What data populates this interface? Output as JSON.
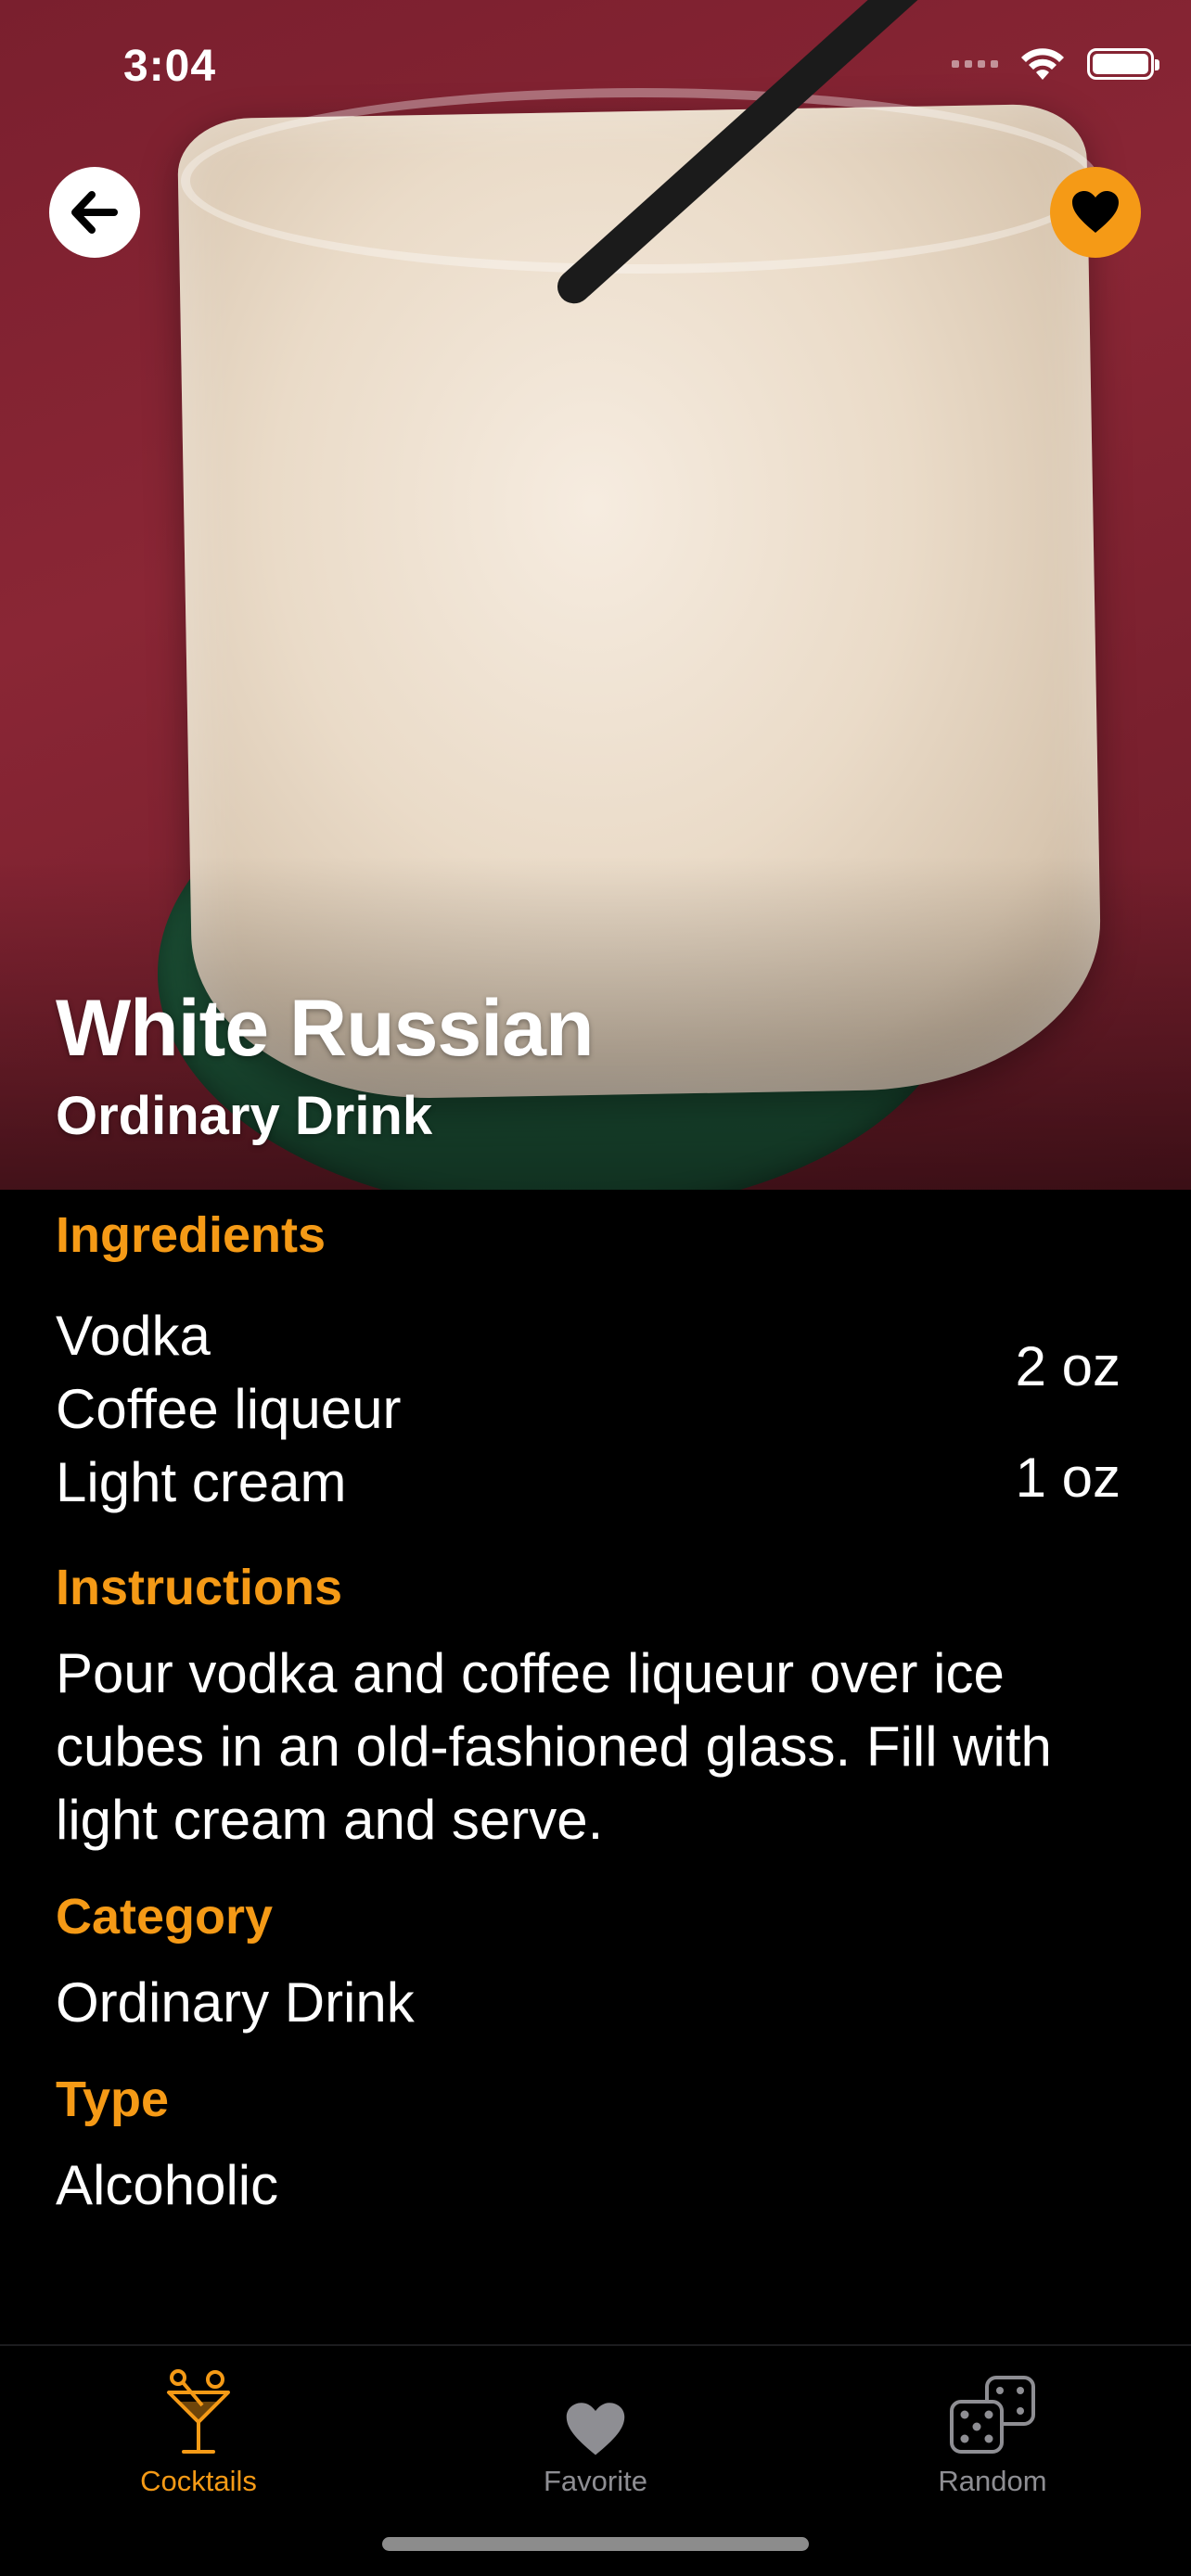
{
  "status": {
    "time": "3:04"
  },
  "drink": {
    "name": "White Russian",
    "category_subtitle": "Ordinary Drink"
  },
  "ingredients": {
    "heading": "Ingredients",
    "items": [
      {
        "name": "Vodka"
      },
      {
        "name": "Coffee liqueur"
      },
      {
        "name": "Light cream"
      }
    ],
    "measures": [
      "2 oz",
      "1 oz"
    ]
  },
  "instructions": {
    "heading": "Instructions",
    "text": "Pour vodka and coffee liqueur over ice cubes in an old-fashioned glass. Fill with light cream and serve."
  },
  "category": {
    "heading": "Category",
    "value": "Ordinary Drink"
  },
  "type": {
    "heading": "Type",
    "value": "Alcoholic"
  },
  "tabs": [
    {
      "label": "Cocktails",
      "icon": "cocktail-icon",
      "active": true
    },
    {
      "label": "Favorite",
      "icon": "heart-icon",
      "active": false
    },
    {
      "label": "Random",
      "icon": "dice-icon",
      "active": false
    }
  ],
  "colors": {
    "accent": "#f59a16",
    "background": "#000000",
    "inactive": "#8e8e93"
  }
}
